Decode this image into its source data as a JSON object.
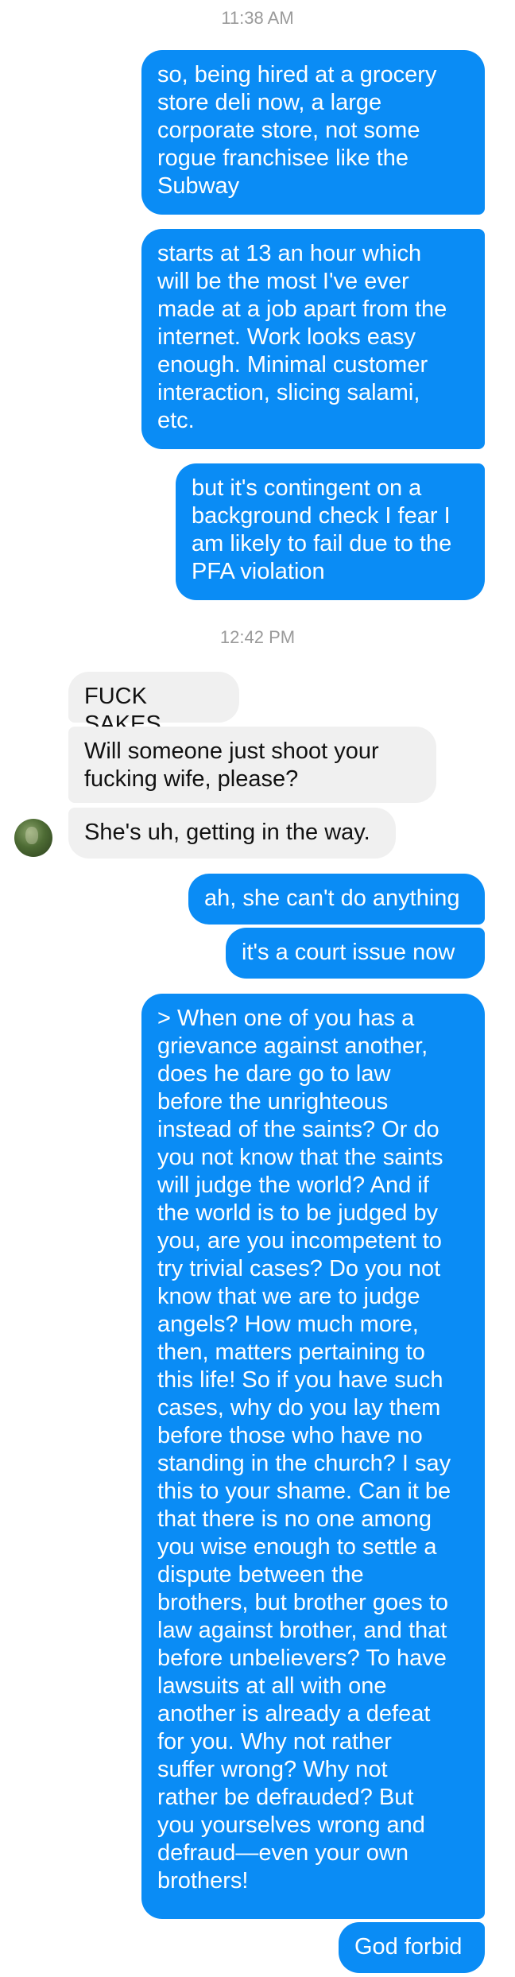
{
  "conversation": {
    "timestamps": [
      "11:38 AM",
      "12:42 PM"
    ],
    "messages": [
      {
        "from": "me",
        "text": "so, being hired at a grocery\nstore deli now, a large\ncorporate store, not some\nrogue franchisee like the\nSubway"
      },
      {
        "from": "me",
        "text": "starts at 13 an hour which\nwill be the most I've ever\nmade at a job apart from the\ninternet. Work looks easy\nenough. Minimal customer\ninteraction, slicing salami,\netc."
      },
      {
        "from": "me",
        "text": "but it's contingent on a\nbackground check I fear I\nam likely to fail due to the\nPFA violation"
      },
      {
        "from": "them",
        "text": "FUCK SAKES"
      },
      {
        "from": "them",
        "text": "Will someone just shoot your\nfucking wife, please?"
      },
      {
        "from": "them",
        "text": "She's uh, getting in the way."
      },
      {
        "from": "me",
        "text": "ah, she can't do anything"
      },
      {
        "from": "me",
        "text": "it's a court issue now"
      },
      {
        "from": "me",
        "text": "> When one of you has a\ngrievance against another,\ndoes he dare go to law\nbefore the unrighteous\ninstead of the saints? Or do\nyou not know that the saints\nwill judge the world? And if\nthe world is to be judged by\nyou, are you incompetent to\ntry trivial cases? Do you not\nknow that we are to judge\nangels? How much more,\nthen, matters pertaining to\nthis life! So if you have such\ncases, why do you lay them\nbefore those who have no\nstanding in the church? I say\nthis to your shame. Can it be\nthat there is no one among\nyou wise enough to settle a\ndispute between the\nbrothers, but brother goes to\nlaw against brother, and that\nbefore unbelievers? To have\nlawsuits at all with one\nanother is already a defeat\nfor you. Why not rather\nsuffer wrong? Why not\nrather be defrauded? But\nyou yourselves wrong and\ndefraud—even your own\nbrothers!"
      },
      {
        "from": "me",
        "text": "God forbid"
      }
    ]
  },
  "colors": {
    "outgoing_bubble": "#0a8cf5",
    "incoming_bubble": "#f0f0f0",
    "timestamp_text": "#9a9a9a"
  },
  "icons": {
    "contact_avatar": "avatar"
  }
}
